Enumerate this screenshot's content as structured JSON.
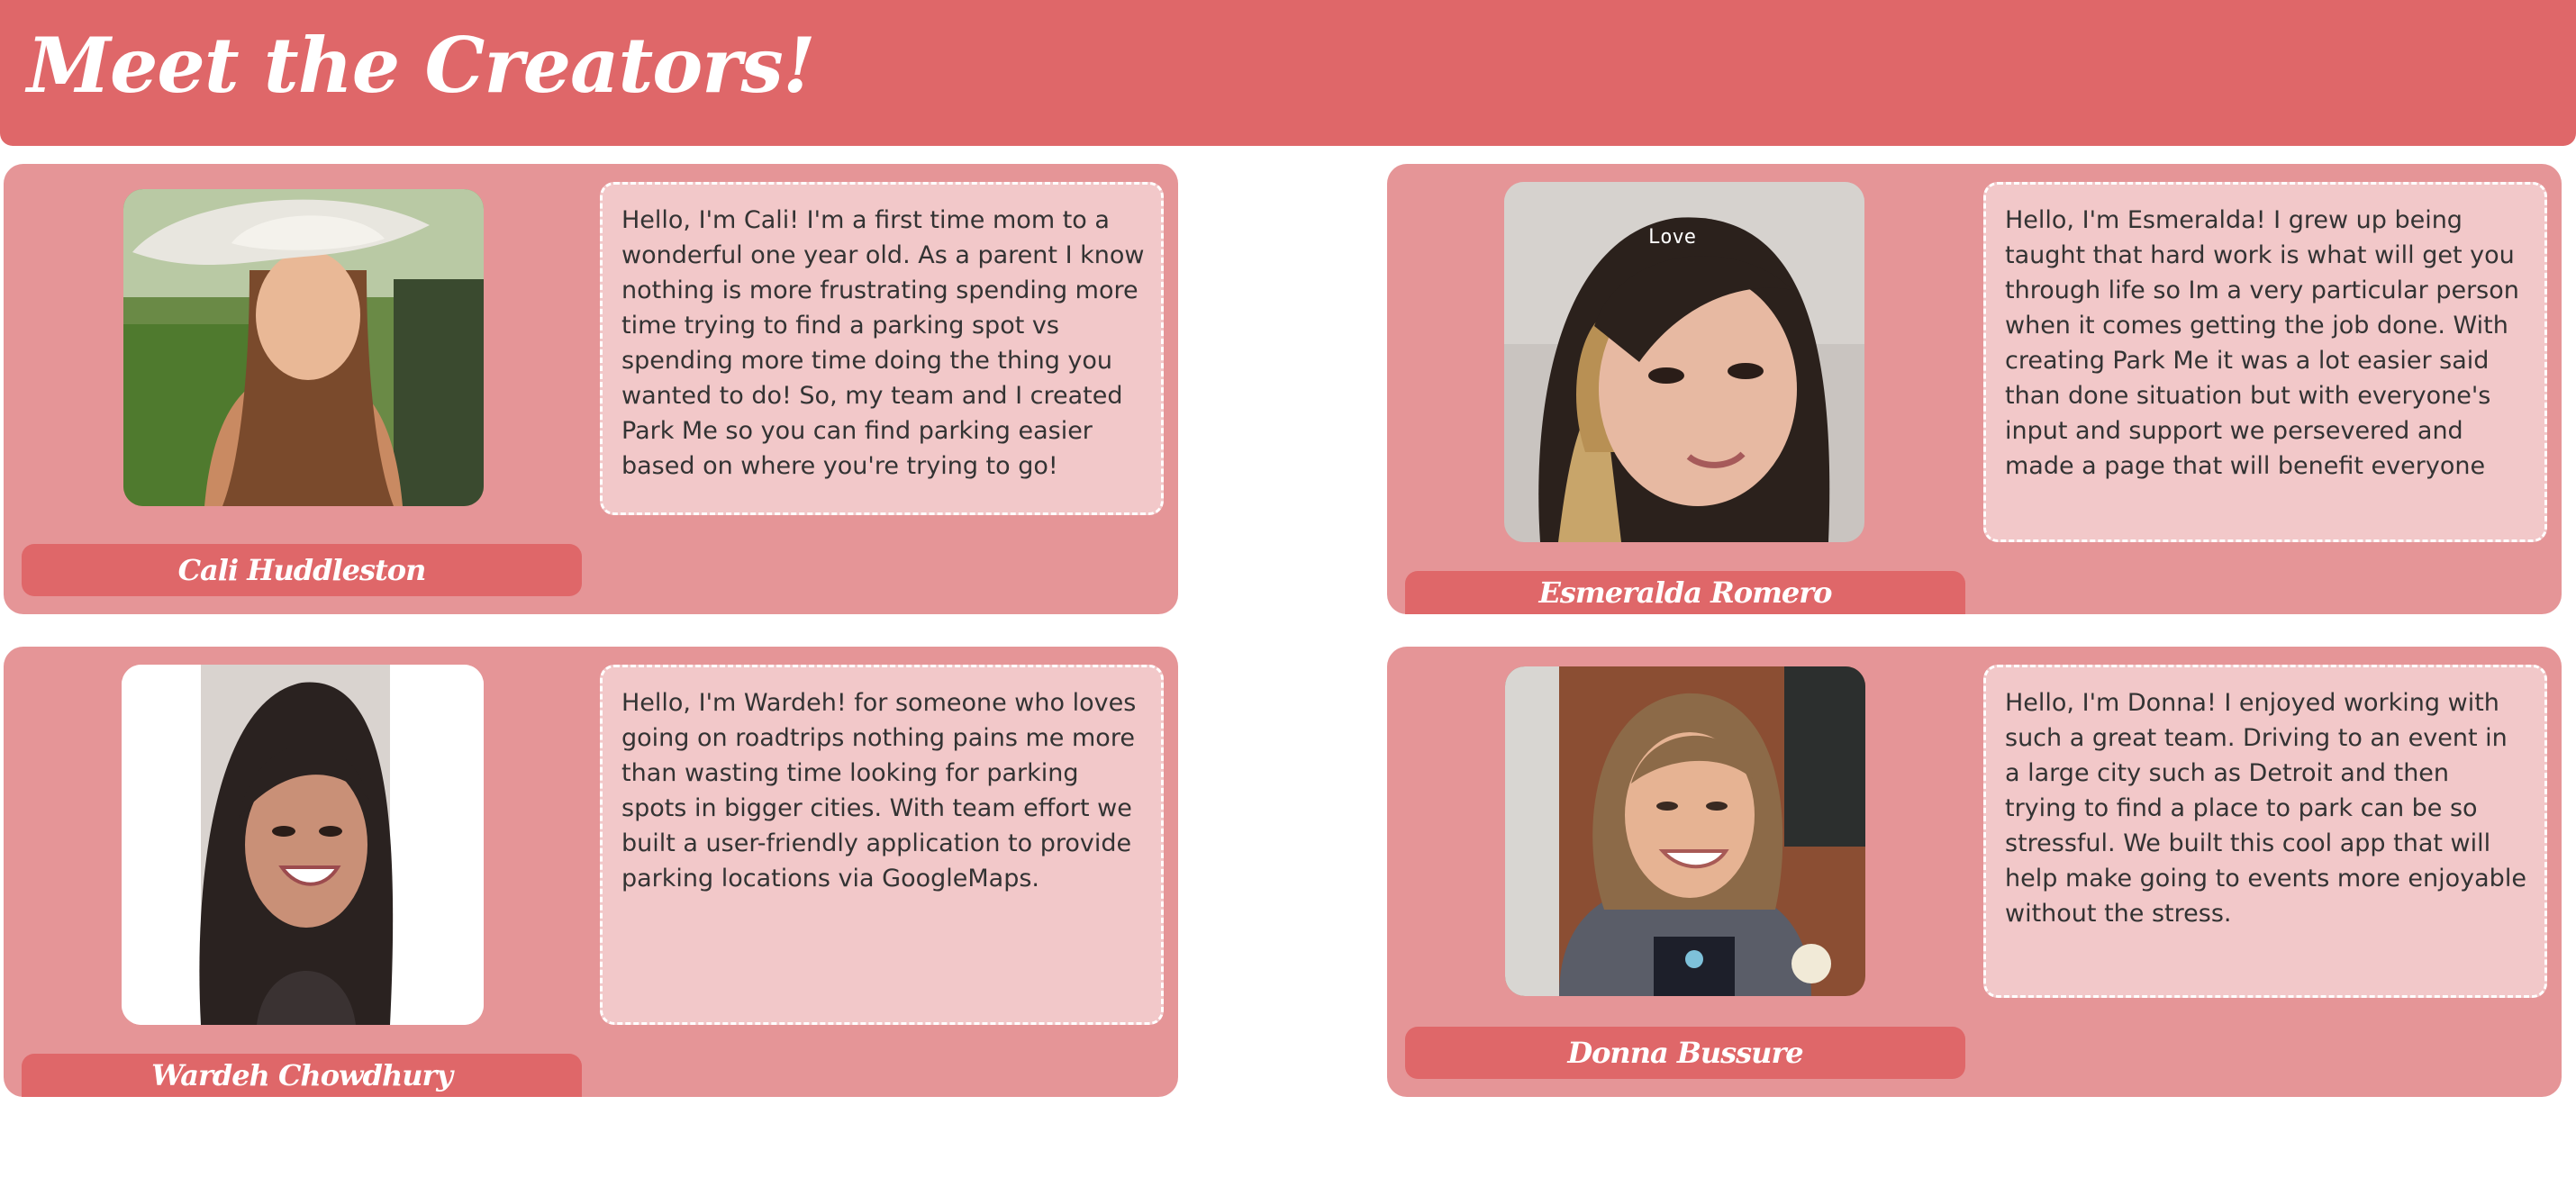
{
  "header": {
    "title": "Meet the Creators!"
  },
  "colors": {
    "header_bg": "#df6769",
    "card_bg": "#e59597",
    "bio_bg": "#f2c8c9",
    "name_pill_bg": "#df6769",
    "text": "#333333"
  },
  "creators": [
    {
      "name": "Cali Huddleston",
      "bio": "Hello, I'm Cali! I'm a first time mom to a wonderful one year old. As a parent I know nothing is more frustrating spending more time trying to find a parking spot vs spending more time doing the thing you wanted to do! So, my team and I created Park Me so you can find parking easier based on where you're trying to go!"
    },
    {
      "name": "Esmeralda Romero",
      "photo_caption": "Love",
      "bio": "Hello, I'm Esmeralda! I grew up being taught that hard work is what will get you through life so Im a very particular person when it comes getting the job done. With creating Park Me it was a lot easier said than done situation but with everyone's input and support we persevered and made a page that will benefit everyone"
    },
    {
      "name": "Wardeh Chowdhury",
      "bio": "Hello, I'm Wardeh! for someone who loves going on roadtrips nothing pains me more than wasting time looking for parking spots in bigger cities. With team effort we built a user-friendly application to provide parking locations via GoogleMaps."
    },
    {
      "name": "Donna Bussure",
      "bio": "Hello, I'm Donna! I enjoyed working with such a great team. Driving to an event in a large city such as Detroit and then trying to find a place to park can be so stressful. We built this cool app that will help make going to events more enjoyable without the stress."
    }
  ]
}
